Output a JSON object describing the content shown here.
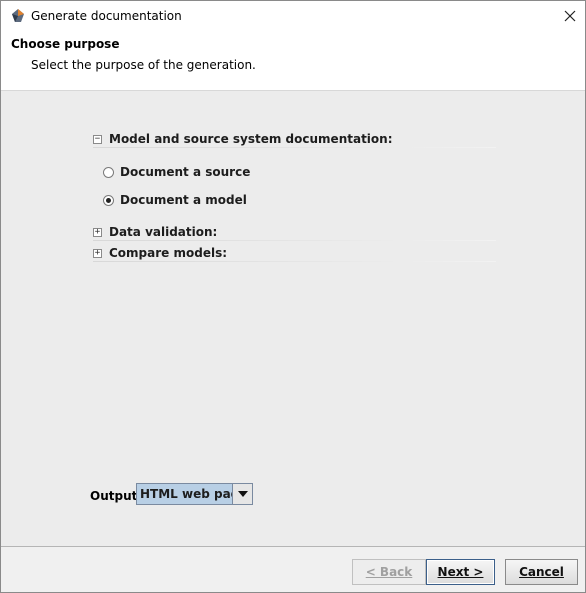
{
  "window": {
    "title": "Generate documentation",
    "icon": "app-shapes-icon",
    "close_icon": "close-icon"
  },
  "header": {
    "title": "Choose purpose",
    "subtitle": "Select the purpose of the generation."
  },
  "sections": [
    {
      "label": "Model and source system documentation:",
      "expanded": true,
      "options": [
        {
          "label": "Document a source",
          "checked": false
        },
        {
          "label": "Document a model",
          "checked": true
        }
      ]
    },
    {
      "label": "Data validation:",
      "expanded": false
    },
    {
      "label": "Compare models:",
      "expanded": false
    }
  ],
  "output": {
    "label": "Output:",
    "value": "HTML web page"
  },
  "buttons": {
    "back": "< Back",
    "next": "Next >",
    "cancel": "Cancel"
  },
  "colors": {
    "selected_combo": "#b8cfe5",
    "content_bg": "#ececec"
  }
}
